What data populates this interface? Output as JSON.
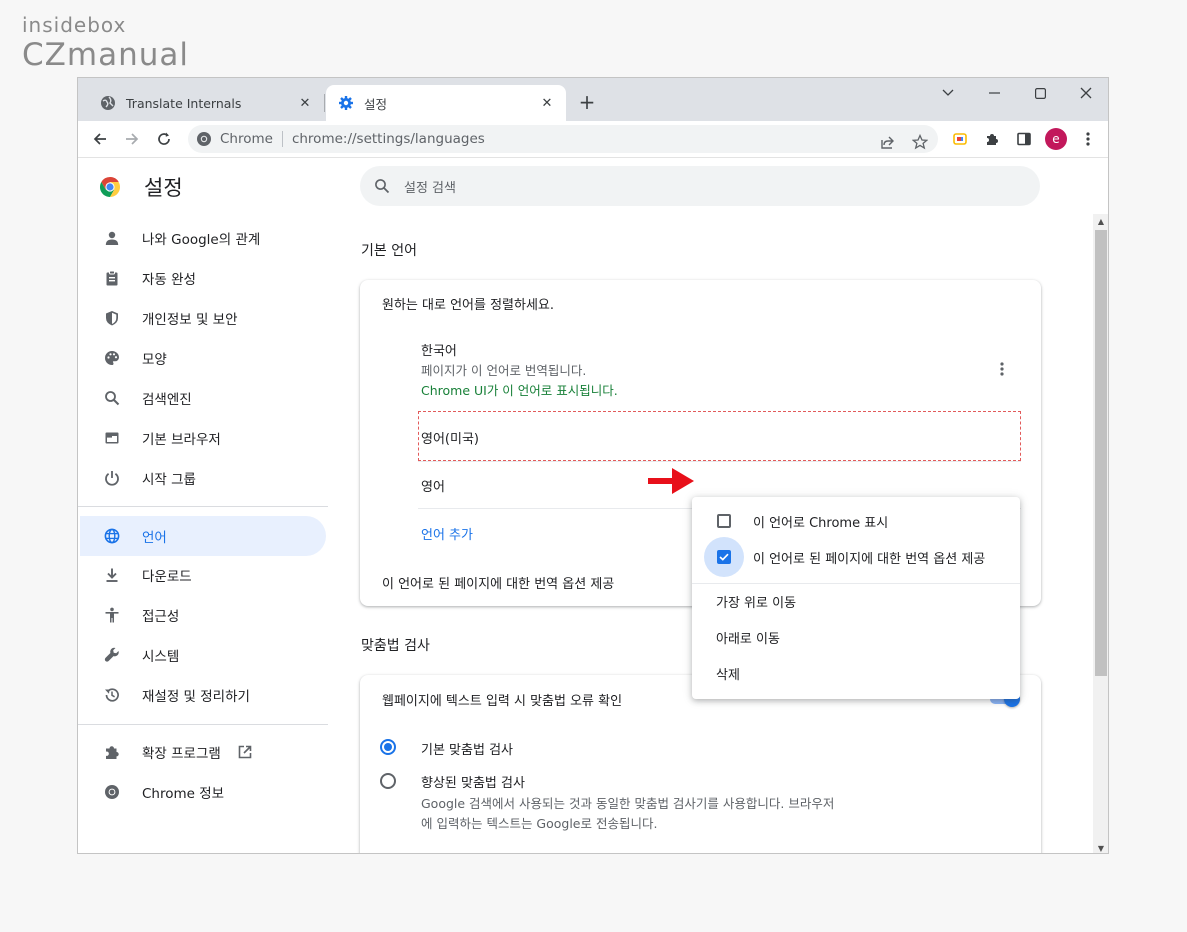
{
  "watermark": {
    "line1": "insidebox",
    "line2": "CZmanual"
  },
  "tabs": [
    {
      "label": "Translate Internals",
      "icon": "globe-icon"
    },
    {
      "label": "설정",
      "icon": "gear-icon"
    }
  ],
  "toolbar": {
    "site_label": "Chrome",
    "url": "chrome://settings/languages",
    "avatar_letter": "e"
  },
  "app": {
    "title": "설정",
    "search_placeholder": "설정 검색"
  },
  "nav": {
    "items": [
      {
        "label": "나와 Google의 관계",
        "icon": "person-icon"
      },
      {
        "label": "자동 완성",
        "icon": "clipboard-icon"
      },
      {
        "label": "개인정보 및 보안",
        "icon": "shield-icon"
      },
      {
        "label": "모양",
        "icon": "palette-icon"
      },
      {
        "label": "검색엔진",
        "icon": "search-icon"
      },
      {
        "label": "기본 브라우저",
        "icon": "browser-icon"
      },
      {
        "label": "시작 그룹",
        "icon": "power-icon"
      },
      {
        "label": "언어",
        "icon": "globe-icon",
        "active": true
      },
      {
        "label": "다운로드",
        "icon": "download-icon"
      },
      {
        "label": "접근성",
        "icon": "accessibility-icon"
      },
      {
        "label": "시스템",
        "icon": "wrench-icon"
      },
      {
        "label": "재설정 및 정리하기",
        "icon": "reset-icon"
      }
    ],
    "extensions_label": "확장 프로그램",
    "about_label": "Chrome 정보"
  },
  "languages": {
    "section_title": "기본 언어",
    "card_header": "원하는 대로 언어를 정렬하세요.",
    "korean": {
      "name": "한국어",
      "desc1": "페이지가 이 언어로 번역됩니다.",
      "desc2": "Chrome UI가 이 언어로 표시됩니다."
    },
    "english_us": "영어(미국)",
    "english": "영어",
    "add_language": "언어 추가",
    "bottom_text": "이 언어로 된 페이지에 대한 번역 옵션 제공"
  },
  "context_menu": {
    "show_chrome": {
      "label": "이 언어로 Chrome 표시",
      "checked": false
    },
    "offer_translate": {
      "label": "이 언어로 된 페이지에 대한 번역 옵션 제공",
      "checked": true
    },
    "move_top": "가장 위로 이동",
    "move_down": "아래로 이동",
    "remove": "삭제"
  },
  "spellcheck": {
    "section_title": "맞춤법 검사",
    "toggle_label": "웹페이지에 텍스트 입력 시 맞춤법 오류 확인",
    "toggle_on": true,
    "basic": "기본 맞춤법 검사",
    "enhanced": "향상된 맞춤법 검사",
    "enhanced_desc1": "Google 검색에서 사용되는 것과 동일한 맞춤법 검사기를 사용합니다. 브라우저",
    "enhanced_desc2": "에 입력하는 텍스트는 Google로 전송됩니다."
  },
  "colors": {
    "accent": "#1a73e8",
    "arrow": "#e8101a"
  }
}
